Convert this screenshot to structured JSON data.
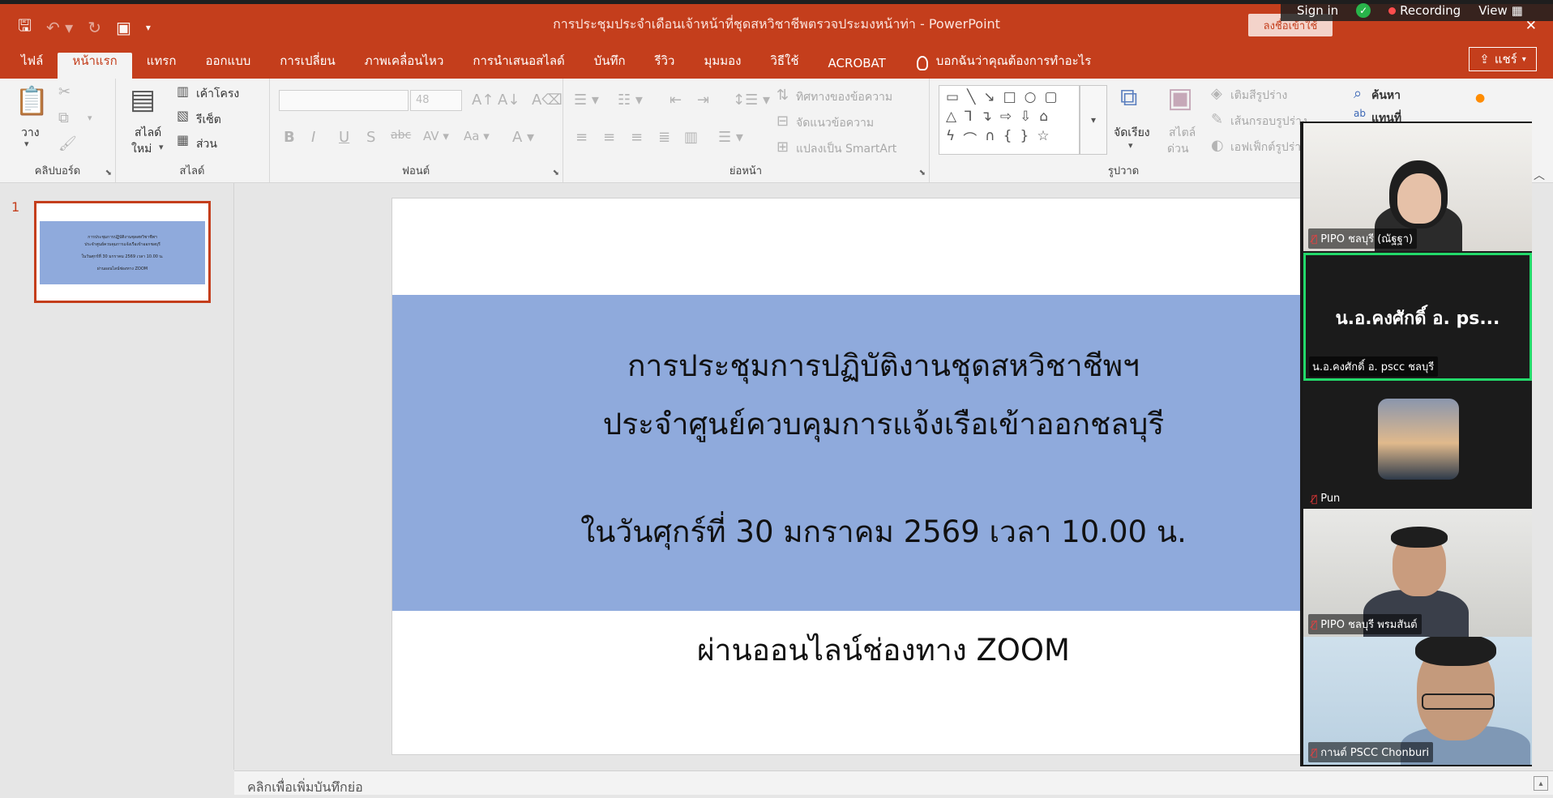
{
  "window": {
    "title": "การประชุมประจำเดือนเจ้าหน้าที่ชุดสหวิชาชีพตรวจประมงหน้าท่า  -  PowerPoint",
    "signin_ppt": "ลงชื่อเข้าใช้"
  },
  "zoom": {
    "sign_in": "Sign in",
    "recording": "Recording",
    "view": "View"
  },
  "tabs": [
    "ไฟล์",
    "หน้าแรก",
    "แทรก",
    "ออกแบบ",
    "การเปลี่ยน",
    "ภาพเคลื่อนไหว",
    "การนำเสนอสไลด์",
    "บันทึก",
    "รีวิว",
    "มุมมอง",
    "วิธีใช้",
    "ACROBAT"
  ],
  "tell_me": "บอกฉันว่าคุณต้องการทำอะไร",
  "share": "แชร์",
  "ribbon": {
    "clipboard": {
      "label": "คลิปบอร์ด",
      "paste": "วาง"
    },
    "slides": {
      "label": "สไลด์",
      "new_slide_1": "สไลด์",
      "new_slide_2": "ใหม่",
      "layout": "เค้าโครง",
      "reset": "รีเซ็ต",
      "section": "ส่วน"
    },
    "font": {
      "label": "ฟอนต์",
      "size": "48"
    },
    "paragraph": {
      "label": "ย่อหน้า",
      "text_direction": "ทิศทางของข้อความ",
      "align_text": "จัดแนวข้อความ",
      "smartart": "แปลงเป็น SmartArt"
    },
    "drawing": {
      "label": "รูปวาด",
      "arrange": "จัดเรียง",
      "quick_styles_1": "สไตล์",
      "quick_styles_2": "ด่วน",
      "fill": "เติมสีรูปร่าง",
      "outline": "เส้นกรอบรูปร่าง",
      "effects": "เอฟเฟ็กต์รูปร่าง"
    },
    "editing": {
      "find": "ค้นหา",
      "replace": "แทนที่"
    }
  },
  "slide_number": "1",
  "slide": {
    "line1": "การประชุมการปฏิบัติงานชุดสหวิชาชีพฯ",
    "line2": "ประจำศูนย์ควบคุมการแจ้งเรือเข้าออกชลบุรี",
    "line3": "ในวันศุกร์ที่ 30 มกราคม 2569 เวลา 10.00 น.",
    "line4": "ผ่านออนไลน์ช่องทาง ZOOM"
  },
  "notes_placeholder": "คลิกเพื่อเพิ่มบันทึกย่อ",
  "participants": [
    {
      "name": "PIPO ชลบุรี (ณัฐฐา)"
    },
    {
      "name": "น.อ.คงศักดิ์ อ. pscc ชลบุรี",
      "display": "น.อ.คงศักดิ์ อ. ps..."
    },
    {
      "name": "Pun"
    },
    {
      "name": "PIPO ชลบุรี พรมสันต์"
    },
    {
      "name": "กานต์ PSCC Chonburi"
    }
  ],
  "colors": {
    "accent": "#c43e1c",
    "slide_band": "#8faadc",
    "active_speaker": "#23d96a"
  }
}
